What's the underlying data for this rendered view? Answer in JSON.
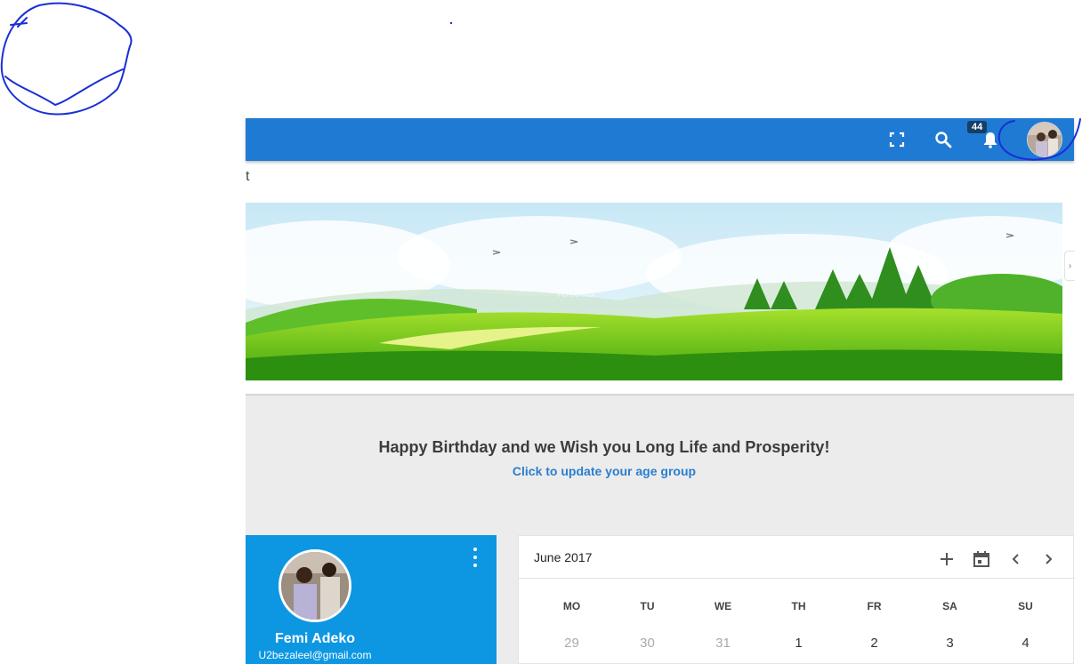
{
  "header": {
    "fullscreen_icon": "fullscreen-icon",
    "search_icon": "search-icon",
    "notifications_icon": "bell-icon",
    "notifications_count": "44",
    "accent_color": "#1f7ad3"
  },
  "page": {
    "stray_text": "t"
  },
  "banner": {
    "watermark": "fotolia"
  },
  "greeting": {
    "message": "Happy Birthday and we Wish you Long Life and Prosperity!",
    "link": "Click to update your age group"
  },
  "profile": {
    "name": "Femi Adeko",
    "email": "U2bezaleel@gmail.com",
    "menu_icon": "more-vert-icon",
    "card_color": "#0d97e3"
  },
  "calendar": {
    "title": "June 2017",
    "add_icon": "plus-icon",
    "today_icon": "calendar-icon",
    "prev_icon": "chevron-left-icon",
    "next_icon": "chevron-right-icon",
    "weekdays": [
      "MO",
      "TU",
      "WE",
      "TH",
      "FR",
      "SA",
      "SU"
    ],
    "days": [
      {
        "label": "29",
        "muted": true
      },
      {
        "label": "30",
        "muted": true
      },
      {
        "label": "31",
        "muted": true
      },
      {
        "label": "1",
        "muted": false
      },
      {
        "label": "2",
        "muted": false
      },
      {
        "label": "3",
        "muted": false
      },
      {
        "label": "4",
        "muted": false
      }
    ]
  }
}
